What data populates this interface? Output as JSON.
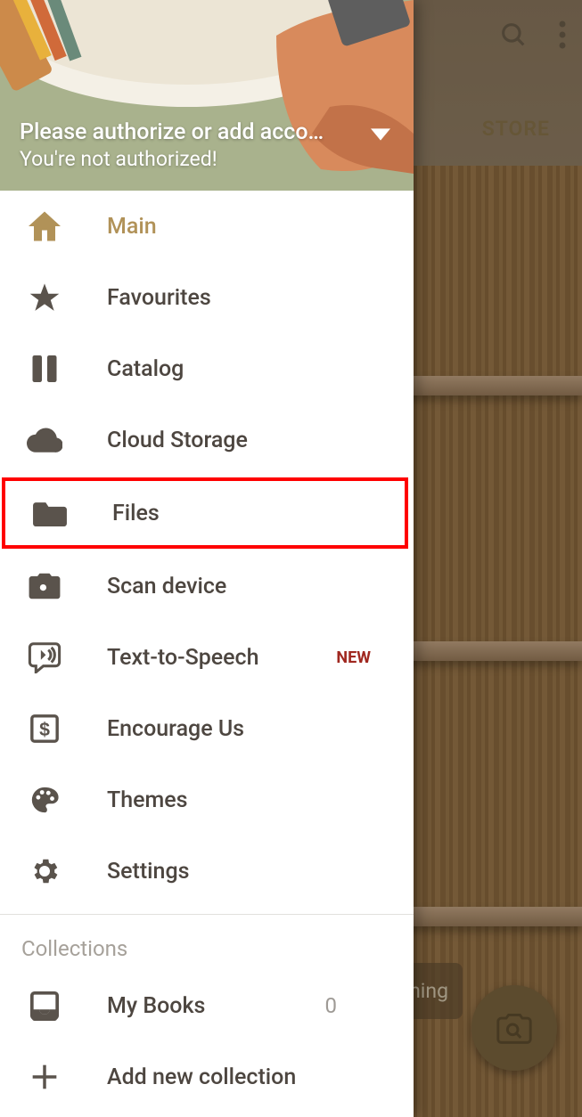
{
  "topbar": {
    "store_tab": "STORE"
  },
  "drawer_header": {
    "line1": "Please authorize or add acco…",
    "line2": "You're not authorized!"
  },
  "nav": {
    "main": "Main",
    "favourites": "Favourites",
    "catalog": "Catalog",
    "cloud_storage": "Cloud Storage",
    "files": "Files",
    "scan_device": "Scan device",
    "tts": "Text-to-Speech",
    "tts_badge": "NEW",
    "encourage": "Encourage Us",
    "themes": "Themes",
    "settings": "Settings"
  },
  "collections": {
    "title": "Collections",
    "my_books": "My Books",
    "my_books_count": "0",
    "add_new": "Add new collection"
  },
  "tooltip_partial": "hing"
}
